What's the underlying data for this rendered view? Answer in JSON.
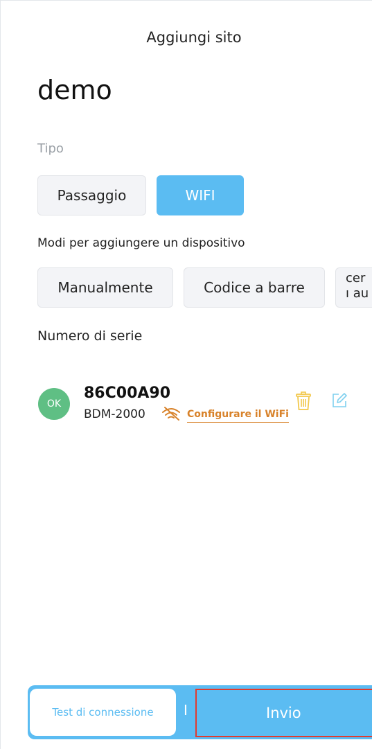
{
  "header": {
    "title": "Aggiungi sito"
  },
  "site": {
    "name": "demo"
  },
  "tipo": {
    "label": "Tipo",
    "options": [
      "Passaggio",
      "WIFI"
    ],
    "selected": "WIFI"
  },
  "add_modes": {
    "label": "Modi per aggiungere un dispositivo",
    "options": [
      "Manualmente",
      "Codice a barre"
    ],
    "partial_line1": "cer",
    "partial_line2": "ı au"
  },
  "serial_section": {
    "label": "Numero di serie"
  },
  "device": {
    "status": "OK",
    "serial": "86C00A90",
    "model": "BDM-2000",
    "config_link": "Configurare il WiFi",
    "wifi_icon": "wifi-off-icon",
    "delete_icon": "trash-icon",
    "edit_icon": "edit-icon"
  },
  "footer": {
    "test_label": "Test di connessione",
    "divider": "I",
    "submit_label": "Invio"
  },
  "colors": {
    "accent": "#5bbcf2",
    "ok_green": "#5fbf84",
    "warning_orange": "#d8822a",
    "highlight_red": "#e23b2e"
  }
}
